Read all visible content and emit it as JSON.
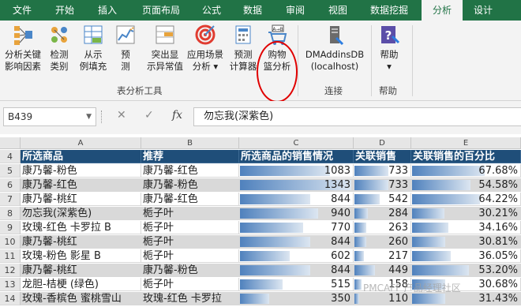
{
  "tabs": [
    {
      "label": "文件",
      "active": false
    },
    {
      "label": "开始",
      "active": false
    },
    {
      "label": "插入",
      "active": false
    },
    {
      "label": "页面布局",
      "active": false
    },
    {
      "label": "公式",
      "active": false
    },
    {
      "label": "数据",
      "active": false
    },
    {
      "label": "审阅",
      "active": false
    },
    {
      "label": "视图",
      "active": false
    },
    {
      "label": "数据挖掘",
      "active": false
    },
    {
      "label": "分析",
      "active": true
    },
    {
      "label": "设计",
      "active": false
    }
  ],
  "ribbon": {
    "buttons": [
      {
        "line1": "分析关键",
        "line2": "影响因素",
        "icon": "key-influencers-icon"
      },
      {
        "line1": "检测",
        "line2": "类别",
        "icon": "detect-categories-icon"
      },
      {
        "line1": "从示",
        "line2": "例填充",
        "icon": "fill-from-example-icon"
      },
      {
        "line1": "预",
        "line2": "测",
        "icon": "forecast-icon"
      },
      {
        "line1": "突出显",
        "line2": "示异常值",
        "icon": "highlight-exceptions-icon"
      },
      {
        "line1": "应用场景",
        "line2": "分析 ▾",
        "icon": "scenario-analysis-icon"
      },
      {
        "line1": "预测",
        "line2": "计算器",
        "icon": "prediction-calculator-icon"
      },
      {
        "line1": "购物",
        "line2": "篮分析",
        "icon": "shopping-basket-icon"
      },
      {
        "line1": "DMAddinsDB",
        "line2": "(localhost)",
        "icon": "connection-icon"
      },
      {
        "line1": "帮助",
        "line2": "▾",
        "icon": "help-icon"
      }
    ],
    "groups": {
      "analysis": "表分析工具",
      "connection": "连接",
      "help": "帮助"
    }
  },
  "formula_bar": {
    "name_box": "B439",
    "cancel": "✕",
    "enter": "✓",
    "fx": "fx",
    "value": "勿忘我(深紫色)"
  },
  "grid": {
    "columns": [
      "A",
      "B",
      "C",
      "D",
      "E"
    ],
    "header_row": {
      "num": "4",
      "cells": [
        "所选商品",
        "推荐",
        "所选商品的销售情况",
        "关联销售",
        "关联销售的百分比"
      ]
    },
    "rows": [
      {
        "num": "5",
        "a": "康乃馨-粉色",
        "b": "康乃馨-红色",
        "c": 1083,
        "d": 733,
        "e": "67.68%",
        "c_frac": 0.81,
        "d_frac": 0.62,
        "e_frac": 0.68
      },
      {
        "num": "6",
        "a": "康乃馨-红色",
        "b": "康乃馨-粉色",
        "c": 1343,
        "d": 733,
        "e": "54.58%",
        "c_frac": 1.0,
        "d_frac": 0.62,
        "e_frac": 0.55
      },
      {
        "num": "7",
        "a": "康乃馨-桃红",
        "b": "康乃馨-红色",
        "c": 844,
        "d": 542,
        "e": "64.22%",
        "c_frac": 0.63,
        "d_frac": 0.46,
        "e_frac": 0.64
      },
      {
        "num": "8",
        "a": "勿忘我(深紫色)",
        "b": "栀子叶",
        "c": 940,
        "d": 284,
        "e": "30.21%",
        "c_frac": 0.7,
        "d_frac": 0.24,
        "e_frac": 0.3
      },
      {
        "num": "9",
        "a": "玫瑰-红色 卡罗拉 B",
        "b": "栀子叶",
        "c": 770,
        "d": 263,
        "e": "34.16%",
        "c_frac": 0.57,
        "d_frac": 0.22,
        "e_frac": 0.34
      },
      {
        "num": "10",
        "a": "康乃馨-桃红",
        "b": "栀子叶",
        "c": 844,
        "d": 260,
        "e": "30.81%",
        "c_frac": 0.63,
        "d_frac": 0.22,
        "e_frac": 0.31
      },
      {
        "num": "11",
        "a": "玫瑰-粉色 影星 B",
        "b": "栀子叶",
        "c": 602,
        "d": 217,
        "e": "36.05%",
        "c_frac": 0.45,
        "d_frac": 0.18,
        "e_frac": 0.36
      },
      {
        "num": "12",
        "a": "康乃馨-桃红",
        "b": "康乃馨-粉色",
        "c": 844,
        "d": 449,
        "e": "53.20%",
        "c_frac": 0.63,
        "d_frac": 0.38,
        "e_frac": 0.53
      },
      {
        "num": "13",
        "a": "龙胆-桔梗 (绿色)",
        "b": "栀子叶",
        "c": 515,
        "d": 158,
        "e": "30.68%",
        "c_frac": 0.38,
        "d_frac": 0.13,
        "e_frac": 0.31
      },
      {
        "num": "14",
        "a": "玫瑰-香槟色 蜜桃雪山",
        "b": "玫瑰-红色 卡罗拉",
        "c": 350,
        "d": 110,
        "e": "31.43%",
        "c_frac": 0.26,
        "d_frac": 0.09,
        "e_frac": 0.31
      }
    ]
  },
  "watermark": "PMCAFF 产品经理社区"
}
